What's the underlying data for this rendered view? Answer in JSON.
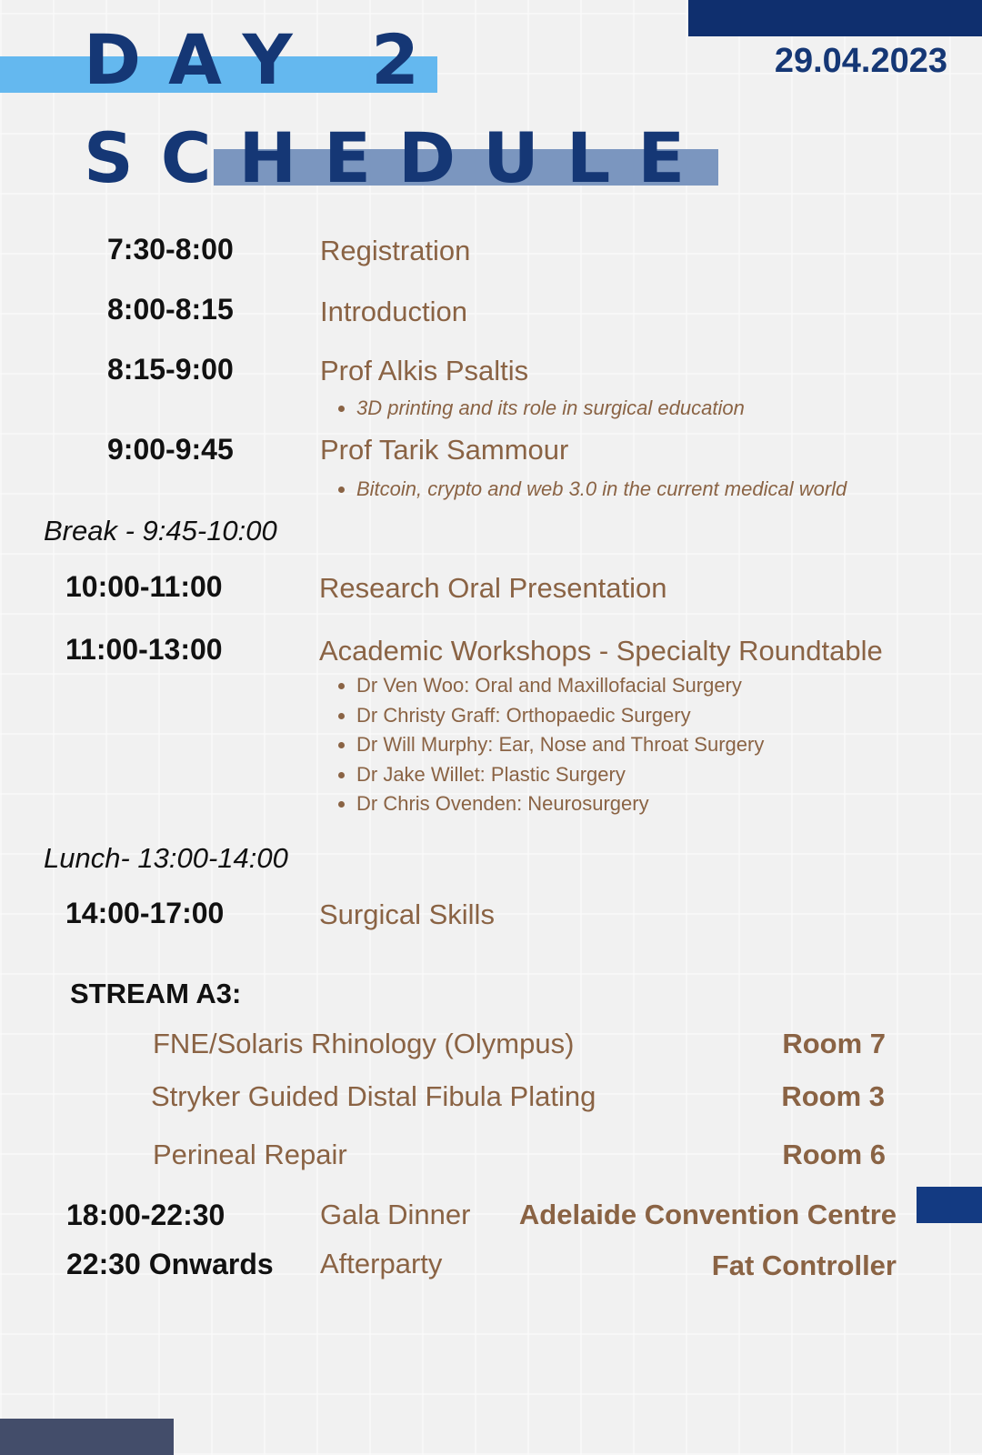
{
  "header": {
    "title_line1": "DAY 2",
    "title_line2": "SCHEDULE",
    "date": "29.04.2023"
  },
  "schedule": [
    {
      "time": "7:30-8:00",
      "event": "Registration"
    },
    {
      "time": "8:00-8:15",
      "event": "Introduction"
    },
    {
      "time": "8:15-9:00",
      "event": "Prof Alkis Psaltis",
      "details": [
        "3D printing and its role in surgical education"
      ]
    },
    {
      "time": "9:00-9:45",
      "event": "Prof Tarik Sammour",
      "details": [
        "Bitcoin, crypto and web 3.0 in the current medical world"
      ]
    },
    {
      "time": "10:00-11:00",
      "event": "Research Oral Presentation"
    },
    {
      "time": "11:00-13:00",
      "event": "Academic Workshops - Specialty Roundtable",
      "details": [
        "Dr Ven Woo: Oral and Maxillofacial Surgery",
        "Dr Christy Graff: Orthopaedic Surgery",
        "Dr Will Murphy: Ear, Nose and Throat Surgery",
        "Dr Jake Willet: Plastic Surgery",
        "Dr Chris Ovenden: Neurosurgery"
      ]
    },
    {
      "time": "14:00-17:00",
      "event": "Surgical Skills"
    },
    {
      "time": "18:00-22:30",
      "event": "Gala Dinner",
      "venue": "Adelaide Convention Centre"
    },
    {
      "time": "22:30 Onwards",
      "event": "Afterparty",
      "venue": "Fat Controller"
    }
  ],
  "breaks": {
    "break": "Break - 9:45-10:00",
    "lunch": "Lunch- 13:00-14:00"
  },
  "stream": {
    "label": "STREAM A3:",
    "sessions": [
      {
        "name": "FNE/Solaris Rhinology (Olympus)",
        "room": "Room 7"
      },
      {
        "name": "Stryker Guided Distal Fibula Plating",
        "room": "Room 3"
      },
      {
        "name": "Perineal Repair",
        "room": "Room 6"
      }
    ]
  },
  "colors": {
    "navy": "#153775",
    "light_blue": "#64b8ef",
    "muted_blue": "#7b96bf",
    "brown": "#8a6344"
  }
}
